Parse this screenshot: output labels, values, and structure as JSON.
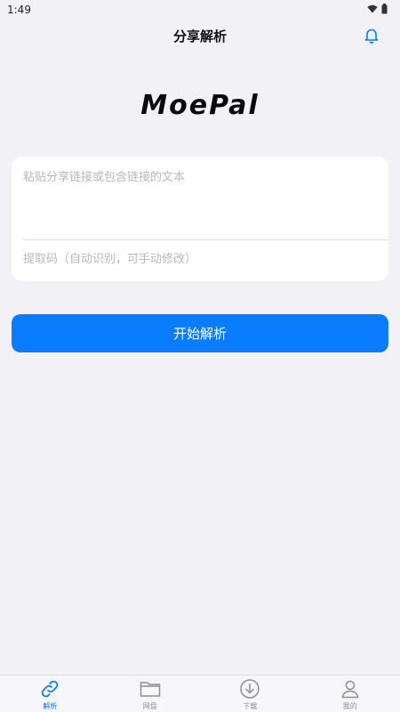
{
  "status_bar": {
    "time": "1:49"
  },
  "header": {
    "title": "分享解析"
  },
  "logo": {
    "text": "MoePal"
  },
  "form": {
    "share_placeholder": "粘贴分享链接或包含链接的文本",
    "code_placeholder": "提取码（自动识别，可手动修改）"
  },
  "actions": {
    "start_label": "开始解析"
  },
  "tabs": [
    {
      "label": "解析",
      "icon": "link-icon",
      "active": true
    },
    {
      "label": "网盘",
      "icon": "folder-icon",
      "active": false
    },
    {
      "label": "下载",
      "icon": "download-icon",
      "active": false
    },
    {
      "label": "我的",
      "icon": "person-icon",
      "active": false
    }
  ],
  "colors": {
    "accent": "#0a7cff",
    "background": "#f1f1f6",
    "inactive": "#8e8e93"
  }
}
